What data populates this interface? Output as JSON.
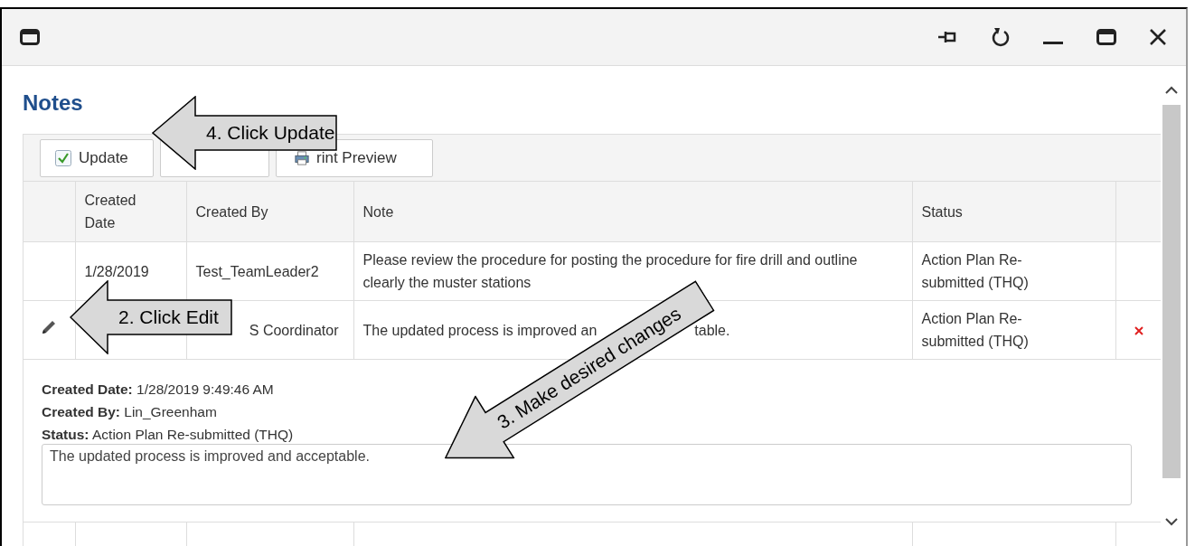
{
  "heading": "Notes",
  "toolbar": [
    {
      "label": "Update",
      "kind": "check"
    },
    {
      "kind": "plain"
    },
    {
      "label": "rint Preview",
      "kind": "print"
    }
  ],
  "columns": [
    "Created Date",
    "Created By",
    "Note",
    "Status"
  ],
  "rows": [
    {
      "created_date": "1/28/2019",
      "created_by": "Test_TeamLeader2",
      "note": "Please review the procedure for posting the procedure for fire drill and outline clearly the muster stations",
      "status": "Action Plan Re-submitted (THQ)",
      "editing": false
    },
    {
      "created_by": "S Coordinator",
      "note": "The updated process is improved an",
      "note_tail": "table.",
      "status": "Action Plan Re-submitted (THQ)",
      "editing": true
    }
  ],
  "detail": {
    "fields": [
      {
        "label": "Created Date:",
        "value": "1/28/2019 9:49:46 AM"
      },
      {
        "label": "Created By:",
        "value": "Lin_Greenham"
      },
      {
        "label": "Status:",
        "value": "Action Plan Re-submitted (THQ)"
      }
    ],
    "note_value": "The updated process is improved and acceptable."
  },
  "callouts": [
    {
      "text": "4. Click Update",
      "kind": "update"
    },
    {
      "text": "2. Click Edit",
      "kind": "edit"
    },
    {
      "text": "3. Make desired changes",
      "kind": "changes"
    }
  ]
}
